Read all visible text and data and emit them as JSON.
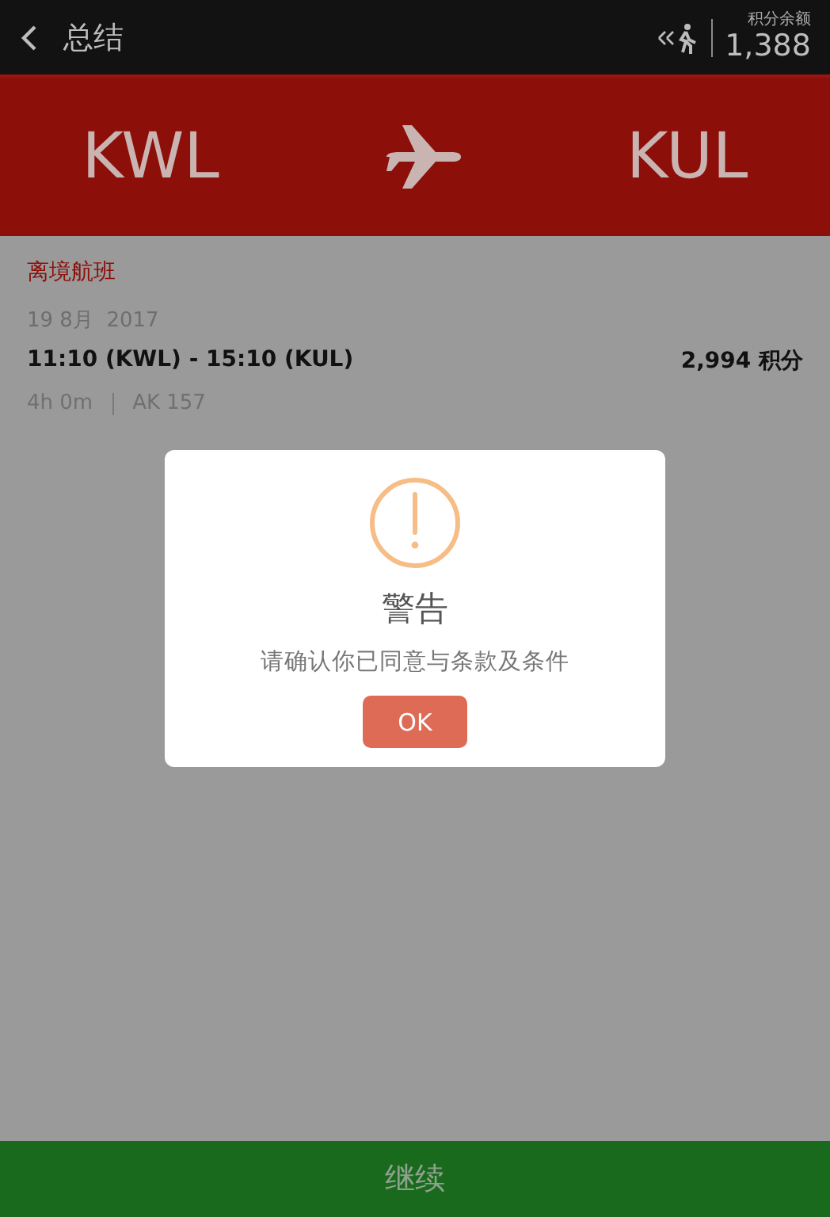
{
  "header": {
    "title": "总结",
    "points_label": "积分余额",
    "points": "1,388"
  },
  "route": {
    "from": "KWL",
    "to": "KUL"
  },
  "flight": {
    "section": "离境航班",
    "date": "19 8月  2017",
    "times": "11:10 (KWL) - 15:10 (KUL)",
    "points": "2,994 积分",
    "duration": "4h 0m",
    "flight_no": "AK 157"
  },
  "dialog": {
    "title": "警告",
    "message": "请确认你已同意与条款及条件",
    "button": "OK"
  },
  "footer": {
    "button": "继续"
  }
}
